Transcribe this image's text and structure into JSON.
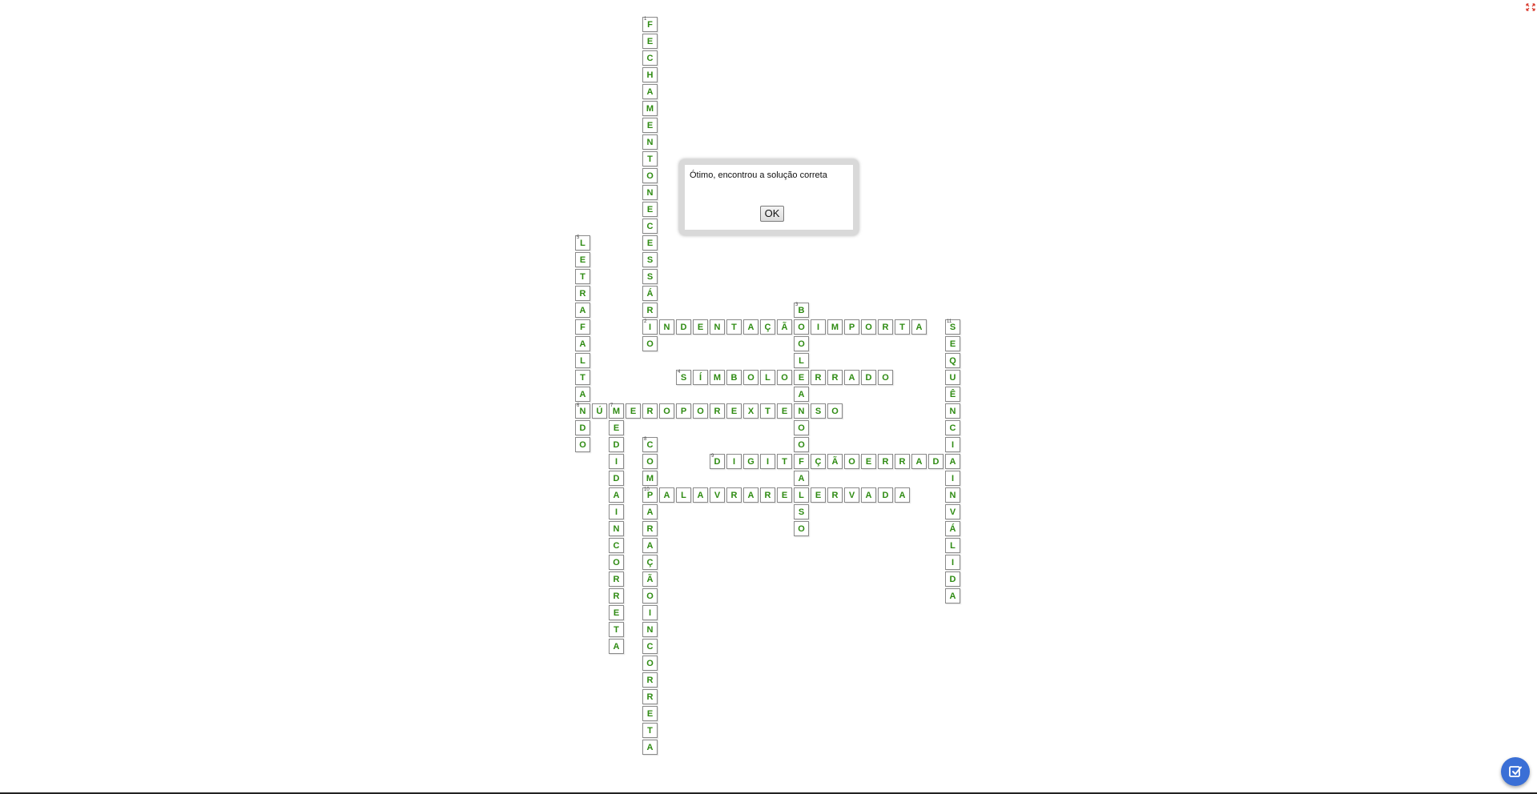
{
  "crossword": {
    "words": [
      {
        "number": "1",
        "answer": "FECHAMENTONECESSÁRIO",
        "direction": "down",
        "row": 0,
        "col": 4
      },
      {
        "number": "2",
        "answer": "INDENTAÇÃOIMPORTA",
        "direction": "across",
        "row": 18,
        "col": 4
      },
      {
        "number": "3",
        "answer": "BOOLEANOOFALSO",
        "direction": "down",
        "row": 17,
        "col": 13
      },
      {
        "number": "4",
        "answer": "SÍMBOLOERRADO",
        "direction": "across",
        "row": 21,
        "col": 6
      },
      {
        "number": "5",
        "answer": "LETRAFALTANDO",
        "direction": "down",
        "row": 13,
        "col": 0
      },
      {
        "number": "6",
        "answer": "NÚMEROPOREXTENSO",
        "direction": "across",
        "row": 23,
        "col": 0
      },
      {
        "number": "7",
        "answer": "MEDIDAINCORRETA",
        "direction": "down",
        "row": 23,
        "col": 2
      },
      {
        "number": "8",
        "answer": "COMPARAÇÃOINCORRETA",
        "direction": "down",
        "row": 25,
        "col": 4
      },
      {
        "number": "9",
        "answer": "DIGITAÇÃOERRADA",
        "direction": "across",
        "row": 26,
        "col": 8
      },
      {
        "number": "10",
        "answer": "PALAVRARESERVADA",
        "direction": "across",
        "row": 28,
        "col": 4
      },
      {
        "number": "11",
        "answer": "SEQUÊNCIAINVÁLIDA",
        "direction": "down",
        "row": 18,
        "col": 22
      }
    ]
  },
  "dialog": {
    "message": "Ótimo, encontrou a solução correta",
    "ok_label": "OK"
  },
  "icons": {
    "fullscreen": "fullscreen-toggle-icon",
    "check": "check-answers-icon"
  },
  "colors": {
    "letter": "#2e8b12",
    "check_button": "#3a6fd6",
    "fullscreen_icon": "#d62d20"
  }
}
